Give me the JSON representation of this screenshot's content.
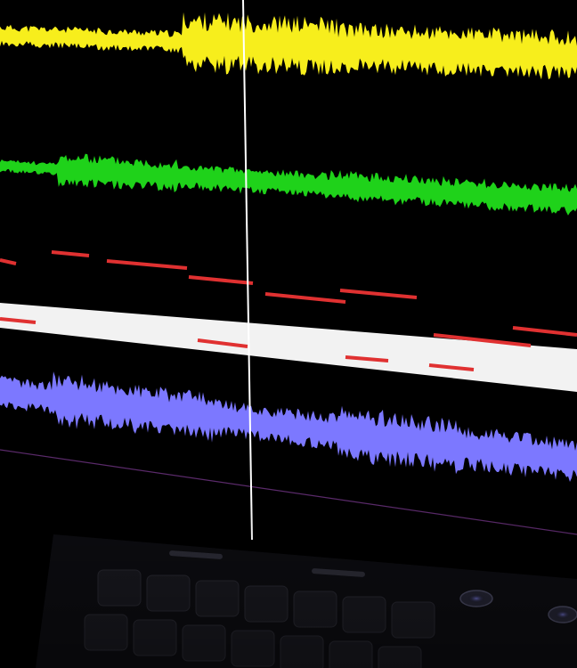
{
  "scene": {
    "description_free": true,
    "background_color": "#000000",
    "tracks": [
      {
        "name": "yellow-waveform-track",
        "color": "#f7ee1c"
      },
      {
        "name": "green-waveform-track",
        "color": "#1fd21a"
      },
      {
        "name": "red-note-track",
        "color": "#e03131"
      },
      {
        "name": "white-highlight-band",
        "color": "#f2f2f2"
      },
      {
        "name": "blue-waveform-track",
        "color": "#7c78ff"
      }
    ],
    "playhead_color": "#ffffff",
    "hardware_color": "#1c1c22"
  }
}
